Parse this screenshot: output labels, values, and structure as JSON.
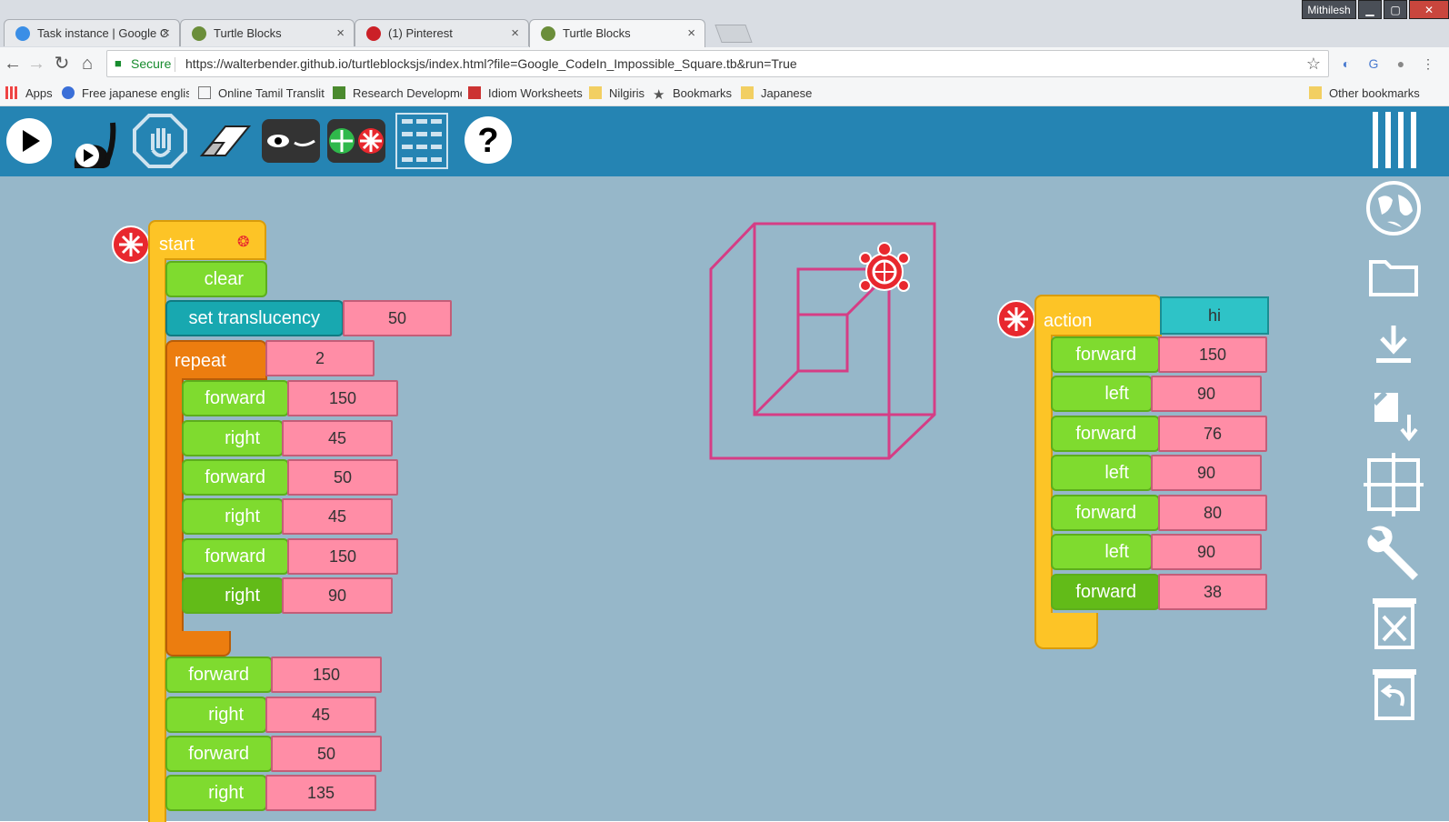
{
  "tabs": [
    {
      "label": "Task instance | Google C",
      "icon": "gear-icon"
    },
    {
      "label": "Turtle Blocks",
      "icon": "turtle-icon"
    },
    {
      "label": "(1) Pinterest",
      "icon": "pinterest-icon"
    },
    {
      "label": "Turtle Blocks",
      "icon": "turtle-icon",
      "active": true
    }
  ],
  "window": {
    "user": "Mithilesh",
    "min": "▁",
    "max": "▢",
    "close": "✕"
  },
  "address": {
    "secure_label": "Secure",
    "url": "https://walterbender.github.io/turtleblocksjs/index.html?file=Google_CodeIn_Impossible_Square.tb&run=True"
  },
  "bookmarks": [
    {
      "label": "Apps",
      "icon": "apps-grid-icon"
    },
    {
      "label": "Free japanese englis",
      "icon": "site-icon"
    },
    {
      "label": "Online Tamil Translit",
      "icon": "page-icon"
    },
    {
      "label": "Research Developme",
      "icon": "site-icon"
    },
    {
      "label": "Idiom Worksheets",
      "icon": "site-icon"
    },
    {
      "label": "Nilgiris",
      "icon": "folder-icon"
    },
    {
      "label": "Bookmarks",
      "icon": "star-icon"
    },
    {
      "label": "Japanese",
      "icon": "folder-icon"
    },
    {
      "label": "Other bookmarks",
      "icon": "folder-icon"
    }
  ],
  "toolbar": {
    "buttons": [
      "play-icon",
      "slow-run-icon",
      "stop-icon",
      "eraser-icon",
      "hide-blocks-icon",
      "collapse-expand-icon",
      "palette-grid-icon",
      "help-icon"
    ],
    "menu_icon": "menu-bars-icon"
  },
  "sidebar": [
    "globe-icon",
    "open-folder-icon",
    "save-download-icon",
    "save-file-icon",
    "grid-icon",
    "settings-wrench-icon",
    "trash-icon",
    "restore-icon"
  ],
  "start_stack": {
    "hat": "start",
    "clear": "clear",
    "set_translucency": "set translucency",
    "translucency_value": "50",
    "repeat": "repeat",
    "repeat_count": "2",
    "repeat_body": [
      {
        "cmd": "forward",
        "val": "150"
      },
      {
        "cmd": "right",
        "val": "45"
      },
      {
        "cmd": "forward",
        "val": "50"
      },
      {
        "cmd": "right",
        "val": "45"
      },
      {
        "cmd": "forward",
        "val": "150"
      },
      {
        "cmd": "right",
        "val": "90"
      }
    ],
    "after": [
      {
        "cmd": "forward",
        "val": "150"
      },
      {
        "cmd": "right",
        "val": "45"
      },
      {
        "cmd": "forward",
        "val": "50"
      },
      {
        "cmd": "right",
        "val": "135"
      }
    ]
  },
  "action_stack": {
    "hat": "action",
    "name": "hi",
    "body": [
      {
        "cmd": "forward",
        "val": "150"
      },
      {
        "cmd": "left",
        "val": "90"
      },
      {
        "cmd": "forward",
        "val": "76"
      },
      {
        "cmd": "left",
        "val": "90"
      },
      {
        "cmd": "forward",
        "val": "80"
      },
      {
        "cmd": "left",
        "val": "90"
      },
      {
        "cmd": "forward",
        "val": "38"
      }
    ]
  },
  "colors": {
    "toolbar": "#2584b3",
    "canvas": "#96b7c9",
    "pen": "#e0287a",
    "turtle": "#e8282e"
  }
}
